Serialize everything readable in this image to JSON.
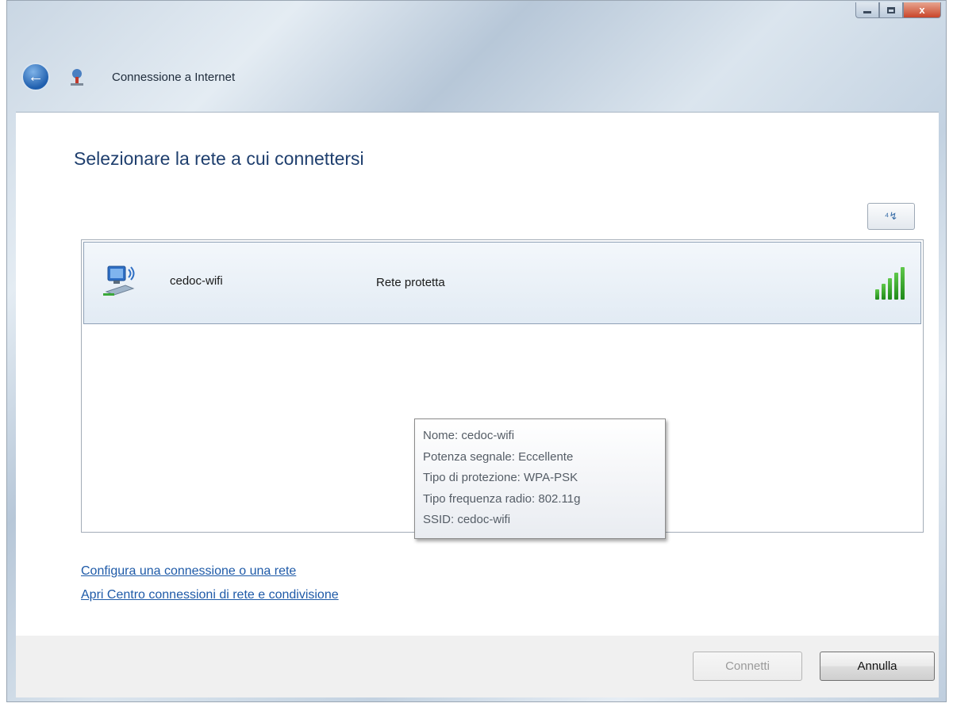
{
  "window": {
    "title": "Connessione a Internet",
    "close_glyph": "x"
  },
  "main": {
    "instruction": "Selezionare la rete a cui connettersi",
    "refresh_glyph": "⁴↯"
  },
  "networks": [
    {
      "name": "cedoc-wifi",
      "security": "Rete protetta",
      "signal_level": 5,
      "signal_max": 5
    }
  ],
  "tooltip": {
    "lines": [
      "Nome: cedoc-wifi",
      "Potenza segnale: Eccellente",
      "Tipo di protezione: WPA-PSK",
      "Tipo frequenza radio: 802.11g",
      "SSID: cedoc-wifi"
    ]
  },
  "links": {
    "setup": "Configura una connessione o una rete",
    "network_center": "Apri Centro connessioni di rete e condivisione"
  },
  "buttons": {
    "connect": "Connetti",
    "cancel": "Annulla"
  },
  "colors": {
    "accent": "#1f3f6e",
    "link": "#1e5aa8",
    "signal": "#2e9a22"
  }
}
